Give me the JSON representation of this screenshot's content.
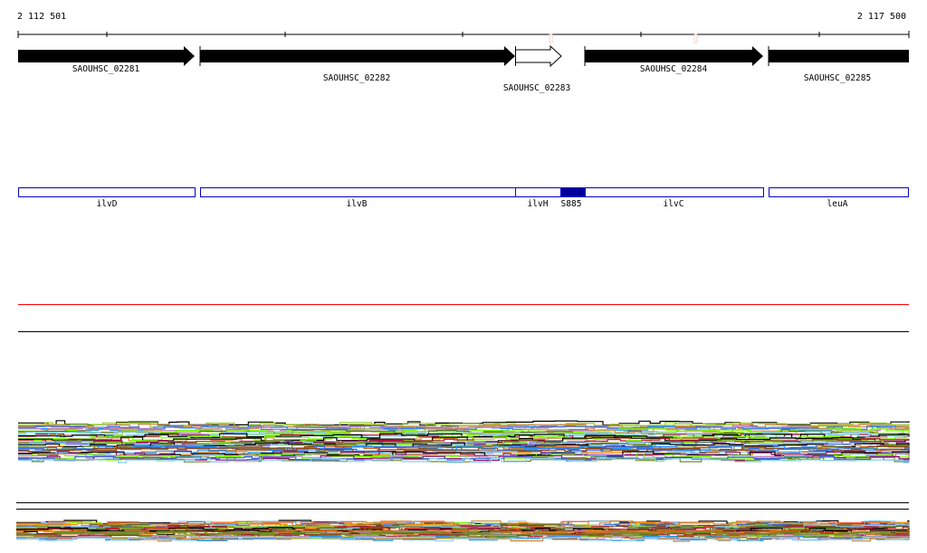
{
  "ruler": {
    "start_label": "2 112 501",
    "end_label": "2 117 500"
  },
  "genes": [
    {
      "locus": "SAOUHSC_02281",
      "name": "ilvD",
      "strand": "+",
      "fill": "#000000"
    },
    {
      "locus": "SAOUHSC_02282",
      "name": "ilvB",
      "strand": "+",
      "fill": "#000000"
    },
    {
      "locus": "SAOUHSC_02283",
      "name": "ilvH",
      "strand": "+",
      "fill": "#ffffff"
    },
    {
      "locus": "SAOUHSC_02284",
      "name": "ilvC",
      "strand": "+",
      "fill": "#000000"
    },
    {
      "locus": "SAOUHSC_02285",
      "name": "leuA",
      "strand": "+",
      "fill": "#000000"
    }
  ],
  "features": [
    {
      "name": "ilvD"
    },
    {
      "name": "ilvB"
    },
    {
      "name": "ilvH"
    },
    {
      "name": "S885",
      "highlighted": true
    },
    {
      "name": "ilvC"
    },
    {
      "name": "leuA"
    }
  ],
  "colors": {
    "feature_outline": "#0000cc",
    "feature_highlight": "#000099",
    "threshold_line": "#ff0000",
    "track_palette": [
      "#000000",
      "#8b0a6e",
      "#b0103a",
      "#d2691e",
      "#ff6347",
      "#cd853f",
      "#9acd32",
      "#7cfc00",
      "#87cefa",
      "#6a8e23",
      "#c080c0",
      "#4169e1",
      "#8b4513",
      "#ff8c00",
      "#1e90ff",
      "#556b2f"
    ]
  }
}
